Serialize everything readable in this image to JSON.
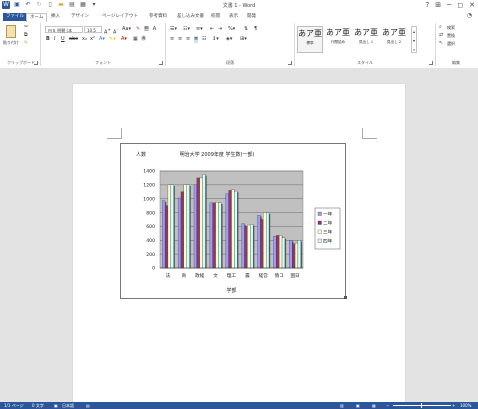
{
  "window": {
    "title": "文書 1 - Word",
    "help": "?",
    "minimize": "─",
    "close": "✕"
  },
  "tabs": [
    {
      "label": "ファイル"
    },
    {
      "label": "ホーム"
    },
    {
      "label": "挿入"
    },
    {
      "label": "デザイン"
    },
    {
      "label": "ページレイアウト"
    },
    {
      "label": "参考資料"
    },
    {
      "label": "差し込み文書"
    },
    {
      "label": "校閲"
    },
    {
      "label": "表示"
    },
    {
      "label": "開発"
    }
  ],
  "ribbon": {
    "paste_label": "貼り付け",
    "clipboard_label": "クリップボード",
    "font_name": "ＭＳ 明朝 (本",
    "font_size": "10.5",
    "font_group": "フォント",
    "paragraph_group": "段落",
    "styles_group": "スタイル",
    "editing_group": "編集",
    "find": "検索",
    "replace": "置換",
    "select": "選択",
    "styles": [
      {
        "preview": "あア亜",
        "name": "標準",
        "selected": true
      },
      {
        "preview": "あア亜",
        "name": "行間詰め",
        "selected": false
      },
      {
        "preview": "あア亜",
        "name": "見出し 1",
        "selected": false
      },
      {
        "preview": "あア亜",
        "name": "見出し 2",
        "selected": false
      }
    ]
  },
  "status": {
    "page": "1/1 ページ",
    "words": "0 文字",
    "language": "日本語",
    "zoom": "100%"
  },
  "chart_data": {
    "type": "bar",
    "title": "明治大学 2009年度 学生数(一部)",
    "ylabel": "人数",
    "xlabel": "学部",
    "ylim": [
      0,
      1400
    ],
    "yticks": [
      0,
      200,
      400,
      600,
      800,
      1000,
      1200,
      1400
    ],
    "categories": [
      "法",
      "商",
      "政経",
      "文",
      "理工",
      "農",
      "経営",
      "情コ",
      "国日"
    ],
    "legend": "right",
    "grid": true,
    "series": [
      {
        "name": "一年",
        "color": "#9999ff",
        "values": [
          970,
          1010,
          1200,
          940,
          1070,
          640,
          760,
          460,
          400
        ]
      },
      {
        "name": "二年",
        "color": "#993366",
        "values": [
          900,
          1100,
          1300,
          940,
          1120,
          600,
          700,
          470,
          350
        ]
      },
      {
        "name": "三年",
        "color": "#ffffcc",
        "values": [
          1200,
          1200,
          1300,
          950,
          1130,
          620,
          800,
          470,
          360
        ]
      },
      {
        "name": "四年",
        "color": "#ccffff",
        "values": [
          1200,
          1200,
          1350,
          940,
          1110,
          630,
          800,
          440,
          400
        ]
      }
    ]
  }
}
